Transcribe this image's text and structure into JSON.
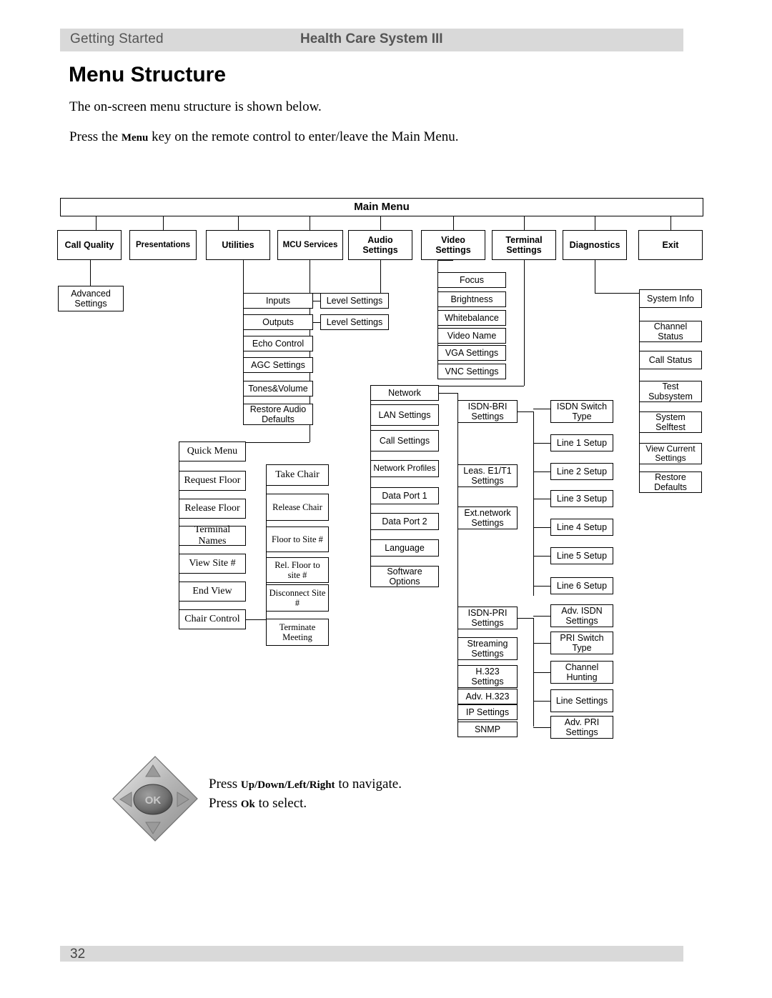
{
  "header": {
    "left": "Getting Started",
    "right": "Health Care System III"
  },
  "title": "Menu Structure",
  "paragraphs": {
    "p1": "The on-screen menu structure is shown below.",
    "p2_before": "Press the ",
    "p2_menu": "Menu",
    "p2_after": " key on the remote control to enter/leave the Main Menu."
  },
  "diagram": {
    "root": "Main Menu",
    "level1": [
      "Call Quality",
      "Presentations",
      "Utilities",
      "MCU Services",
      "Audio Settings",
      "Video Settings",
      "Terminal Settings",
      "Diagnostics",
      "Exit"
    ],
    "call_quality": [
      "Advanced Settings"
    ],
    "audio": [
      "Inputs",
      "Outputs",
      "Echo Control",
      "AGC Settings",
      "Tones&Volume",
      "Restore Audio Defaults"
    ],
    "audio_sub": [
      "Level Settings",
      "Level Settings"
    ],
    "video": [
      "Focus",
      "Brightness",
      "Whitebalance",
      "Video Name",
      "VGA Settings",
      "VNC Settings"
    ],
    "mcu": [
      "Quick Menu",
      "Request Floor",
      "Release Floor",
      "Terminal Names",
      "View Site #",
      "End View",
      "Chair Control"
    ],
    "mcu_sub": [
      "Take Chair",
      "Release Chair",
      "Floor to Site #",
      "Rel. Floor to site #",
      "Disconnect Site #",
      "Terminate Meeting"
    ],
    "terminal": [
      "Network",
      "LAN Settings",
      "Call Settings",
      "Network Profiles",
      "Data Port 1",
      "Data Port 2",
      "Language",
      "Software Options"
    ],
    "network_sub": [
      "ISDN-BRI Settings",
      "Leas. E1/T1 Settings",
      "Ext.network Settings",
      "ISDN-PRI Settings",
      "Streaming Settings",
      "H.323 Settings",
      "Adv. H.323",
      "IP Settings",
      "SNMP"
    ],
    "bri_sub": [
      "ISDN Switch Type",
      "Line 1 Setup",
      "Line 2 Setup",
      "Line 3 Setup",
      "Line 4 Setup",
      "Line 5 Setup",
      "Line 6 Setup"
    ],
    "pri_sub": [
      "Adv. ISDN Settings",
      "PRI Switch Type",
      "Channel Hunting",
      "Line Settings",
      "Adv. PRI Settings"
    ],
    "diagnostics": [
      "System Info",
      "Channel Status",
      "Call Status",
      "Test Subsystem",
      "System Selftest",
      "View Current Settings",
      "Restore Defaults"
    ]
  },
  "footer_note": {
    "line1_before": "Press ",
    "line1_keys": "Up/Down/Left/Right",
    "line1_after": " to navigate.",
    "line2_before": "Press ",
    "line2_keys": "Ok",
    "line2_after": " to select.",
    "ok_label": "OK"
  },
  "page_number": "32"
}
